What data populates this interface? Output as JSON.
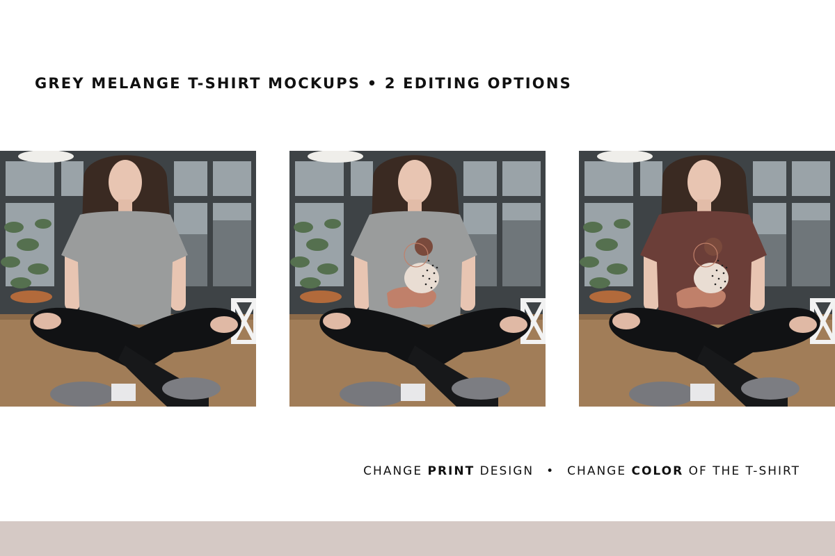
{
  "headline": "GREY MELANGE T-SHIRT MOCKUPS • 2 EDITING OPTIONS",
  "photos": [
    {
      "variant": "blank grey t-shirt",
      "shirt_color": "#9a9c9c",
      "has_print": false
    },
    {
      "variant": "grey t-shirt with abstract print",
      "shirt_color": "#9a9c9c",
      "has_print": true
    },
    {
      "variant": "maroon t-shirt with abstract print",
      "shirt_color": "#6b3e38",
      "has_print": true
    }
  ],
  "caption": {
    "left_prefix": "CHANGE ",
    "left_bold": "PRINT",
    "left_suffix": " DESIGN",
    "separator": "•",
    "right_prefix": "CHANGE ",
    "right_bold": "COLOR",
    "right_suffix": " OF THE T-SHIRT"
  },
  "colors": {
    "footer_band": "#d5c9c5",
    "print_brown": "#7a4a3c",
    "print_terracotta": "#c0806a",
    "print_cream": "#e9ddd3"
  }
}
